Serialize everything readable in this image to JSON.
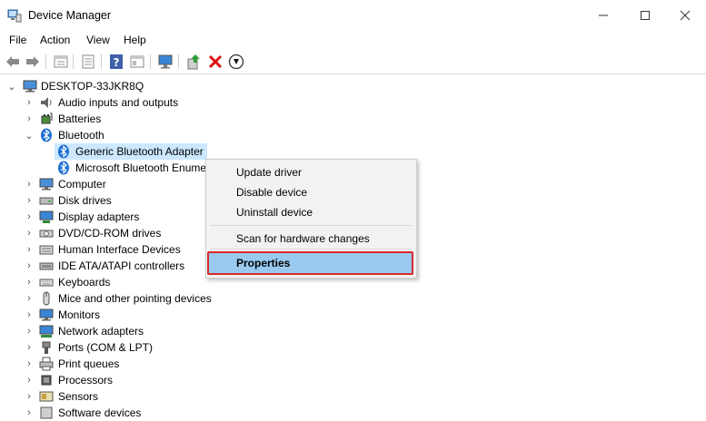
{
  "window": {
    "title": "Device Manager",
    "icon": "device-manager-icon",
    "controls": [
      "minimize",
      "maximize",
      "close"
    ]
  },
  "menu": {
    "file": "File",
    "action": "Action",
    "view": "View",
    "help": "Help"
  },
  "toolbar": {
    "buttons": [
      "back-arrow-icon",
      "forward-arrow-icon",
      "properties-list-icon",
      "console-tree-icon",
      "help-icon",
      "details-icon",
      "monitor-icon",
      "update-driver-icon",
      "uninstall-x-icon",
      "scan-download-icon"
    ]
  },
  "tree": {
    "root": "DESKTOP-33JKR8Q",
    "items": [
      {
        "label": "Audio inputs and outputs",
        "icon": "speaker-icon",
        "expanded": false
      },
      {
        "label": "Batteries",
        "icon": "battery-icon",
        "expanded": false
      },
      {
        "label": "Bluetooth",
        "icon": "bluetooth-icon",
        "expanded": true
      },
      {
        "label": "Generic Bluetooth Adapter",
        "icon": "bluetooth-icon",
        "child": true,
        "selected": true
      },
      {
        "label": "Microsoft Bluetooth Enume",
        "icon": "bluetooth-icon",
        "child": true
      },
      {
        "label": "Computer",
        "icon": "computer-icon",
        "expanded": false
      },
      {
        "label": "Disk drives",
        "icon": "disk-drive-icon",
        "expanded": false
      },
      {
        "label": "Display adapters",
        "icon": "display-adapter-icon",
        "expanded": false
      },
      {
        "label": "DVD/CD-ROM drives",
        "icon": "dvd-drive-icon",
        "expanded": false
      },
      {
        "label": "Human Interface Devices",
        "icon": "hid-icon",
        "expanded": false
      },
      {
        "label": "IDE ATA/ATAPI controllers",
        "icon": "ide-controller-icon",
        "expanded": false
      },
      {
        "label": "Keyboards",
        "icon": "keyboard-icon",
        "expanded": false
      },
      {
        "label": "Mice and other pointing devices",
        "icon": "mouse-icon",
        "expanded": false
      },
      {
        "label": "Monitors",
        "icon": "monitor-icon",
        "expanded": false
      },
      {
        "label": "Network adapters",
        "icon": "network-adapter-icon",
        "expanded": false
      },
      {
        "label": "Ports (COM & LPT)",
        "icon": "port-icon",
        "expanded": false
      },
      {
        "label": "Print queues",
        "icon": "printer-icon",
        "expanded": false
      },
      {
        "label": "Processors",
        "icon": "processor-icon",
        "expanded": false
      },
      {
        "label": "Sensors",
        "icon": "sensor-icon",
        "expanded": false
      },
      {
        "label": "Software devices",
        "icon": "software-device-icon",
        "expanded": false
      }
    ]
  },
  "context_menu": {
    "update_driver": "Update driver",
    "disable_device": "Disable device",
    "uninstall_device": "Uninstall device",
    "scan": "Scan for hardware changes",
    "properties": "Properties",
    "highlight_color": "#d82a2a"
  }
}
